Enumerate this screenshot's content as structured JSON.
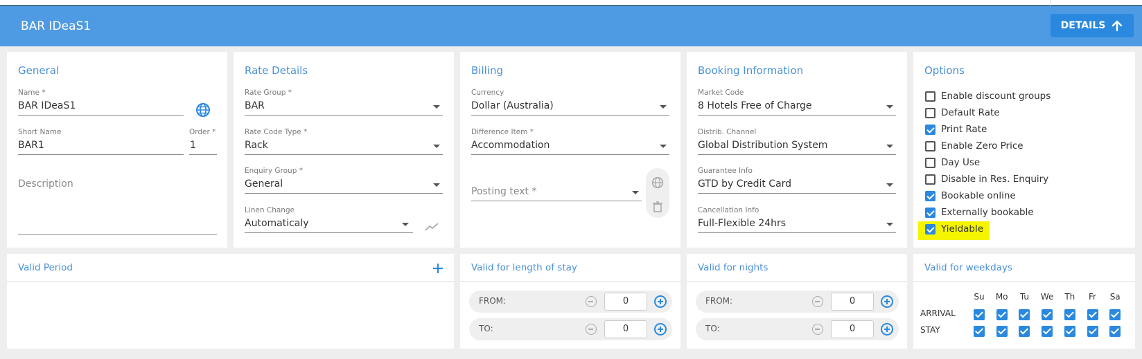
{
  "header": {
    "title": "BAR IDeaS1",
    "details_label": "DETAILS"
  },
  "general": {
    "title": "General",
    "name_label": "Name *",
    "name_value": "BAR IDeaS1",
    "short_name_label": "Short Name",
    "short_name_value": "BAR1",
    "order_label": "Order *",
    "order_value": "1",
    "description_placeholder": "Description"
  },
  "rate_details": {
    "title": "Rate Details",
    "rate_group_label": "Rate Group *",
    "rate_group_value": "BAR",
    "rate_code_type_label": "Rate Code Type *",
    "rate_code_type_value": "Rack",
    "enquiry_group_label": "Enquiry Group *",
    "enquiry_group_value": "General",
    "linen_change_label": "Linen Change",
    "linen_change_value": "Automaticaly"
  },
  "billing": {
    "title": "Billing",
    "currency_label": "Currency",
    "currency_value": "Dollar (Australia)",
    "difference_item_label": "Difference Item *",
    "difference_item_value": "Accommodation",
    "posting_text_placeholder": "Posting text *"
  },
  "booking": {
    "title": "Booking Information",
    "market_code_label": "Market Code",
    "market_code_value": "8 Hotels Free of Charge",
    "distrib_channel_label": "Distrib. Channel",
    "distrib_channel_value": "Global Distribution System",
    "guarantee_label": "Guarantee Info",
    "guarantee_value": "GTD by Credit Card",
    "cancellation_label": "Cancellation Info",
    "cancellation_value": "Full-Flexible 24hrs"
  },
  "options": {
    "title": "Options",
    "items": [
      {
        "label": "Enable discount groups",
        "checked": false
      },
      {
        "label": "Default Rate",
        "checked": false
      },
      {
        "label": "Print Rate",
        "checked": true
      },
      {
        "label": "Enable Zero Price",
        "checked": false
      },
      {
        "label": "Day Use",
        "checked": false
      },
      {
        "label": "Disable in Res. Enquiry",
        "checked": false
      },
      {
        "label": "Bookable online",
        "checked": true
      },
      {
        "label": "Externally bookable",
        "checked": true
      },
      {
        "label": "Yieldable",
        "checked": true
      }
    ],
    "highlight_color": "#f5f500"
  },
  "valid_period": {
    "title": "Valid Period"
  },
  "valid_los": {
    "title": "Valid for length of stay",
    "from_label": "FROM:",
    "from_value": "0",
    "to_label": "TO:",
    "to_value": "0"
  },
  "valid_nights": {
    "title": "Valid for nights",
    "from_label": "FROM:",
    "from_value": "0",
    "to_label": "TO:",
    "to_value": "0"
  },
  "valid_weekdays": {
    "title": "Valid for weekdays",
    "days": [
      "Su",
      "Mo",
      "Tu",
      "We",
      "Th",
      "Fr",
      "Sa"
    ],
    "arrival_label": "ARRIVAL",
    "stay_label": "STAY",
    "arrival": [
      true,
      true,
      true,
      true,
      true,
      true,
      true
    ],
    "stay": [
      true,
      true,
      true,
      true,
      true,
      true,
      true
    ]
  },
  "colors": {
    "header": "#4f9be3",
    "accent": "#2a89de",
    "title_text": "#4a90d9"
  }
}
